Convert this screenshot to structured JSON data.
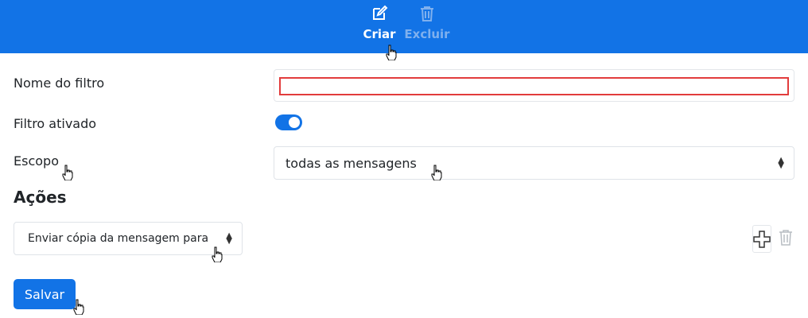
{
  "toolbar": {
    "create_label": "Criar",
    "delete_label": "Excluir",
    "bg_color": "#1273e6"
  },
  "form": {
    "name_label": "Nome do filtro",
    "name_value": "",
    "enabled_label": "Filtro ativado",
    "enabled": true,
    "scope_label": "Escopo",
    "scope_value": "todas as mensagens"
  },
  "actions": {
    "title": "Ações",
    "action_value": "Enviar cópia da mensagem para"
  },
  "save_label": "Salvar",
  "colors": {
    "accent": "#1273e6",
    "error_border": "#e23c3c"
  },
  "icons": [
    "edit-icon",
    "trash-icon",
    "plus-icon",
    "hand-cursor-icon"
  ]
}
